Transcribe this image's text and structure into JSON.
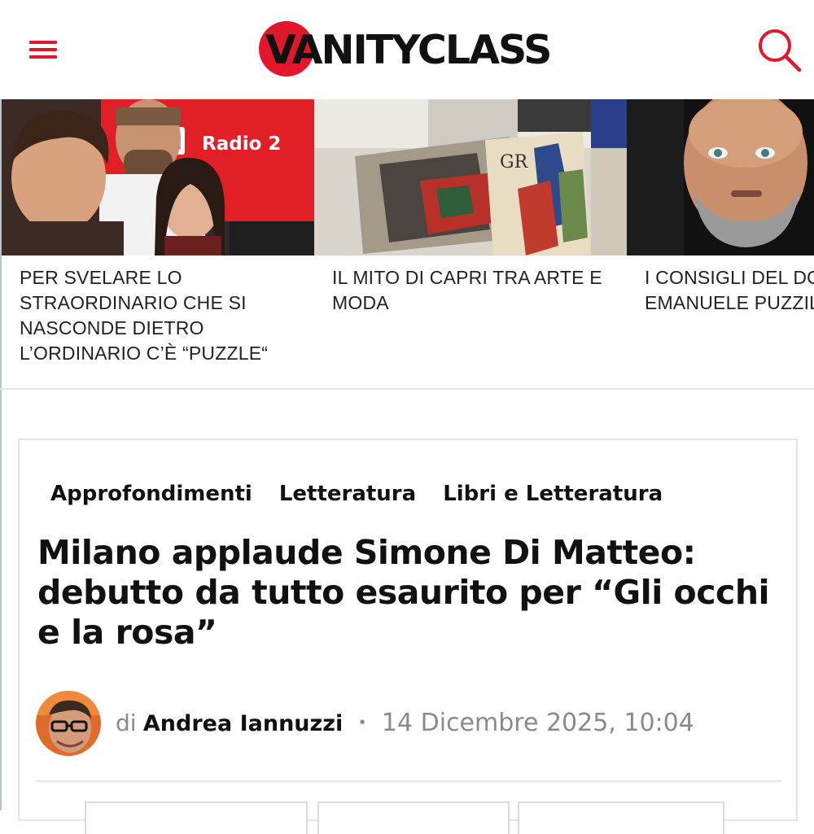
{
  "brand": {
    "logo_text": "VANITYCLASS",
    "accent": "#e2172c"
  },
  "header": {
    "menu_icon": "hamburger-menu-icon",
    "search_icon": "search-icon"
  },
  "strip": {
    "cards": [
      {
        "title": "PER SVELARE LO\nSTRAORDINARIO CHE SI\nNASCONDE DIETRO\nL’ORDINARIO C’È “PUZZLE“",
        "image_caption": "Radio 2"
      },
      {
        "title": "IL MITO DI CAPRI TRA ARTE E\nMODA",
        "image_caption": "GR"
      },
      {
        "title": "I CONSIGLI DEL DO\nEMANUELE PUZZIL"
      }
    ]
  },
  "article": {
    "categories": [
      "Approfondimenti",
      "Letteratura",
      "Libri e Letteratura"
    ],
    "headline": "Milano applaude Simone Di Matteo: debutto da tutto esaurito per “Gli occhi e la rosa”",
    "byline": {
      "prefix": "di",
      "author": "Andrea Iannuzzi",
      "separator": "•",
      "date": "14 Dicembre 2025, 10:04"
    }
  }
}
